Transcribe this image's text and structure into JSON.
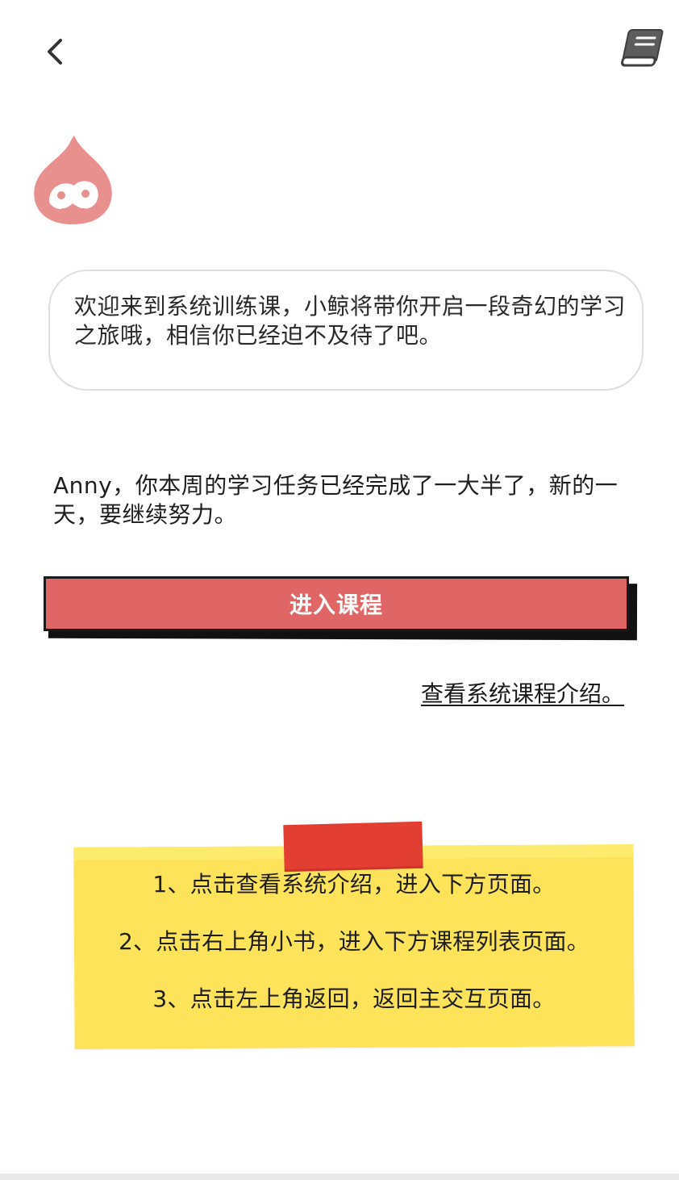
{
  "header": {
    "back_icon": "chevron-left-icon",
    "book_icon": "book-icon"
  },
  "mascot": {
    "icon": "drop-mascot-icon",
    "color": "#e8908e"
  },
  "bubble": {
    "text": "欢迎来到系统训练课，小鲸将带你开启一段奇幻的学习之旅哦，相信你已经迫不及待了吧。"
  },
  "progress": {
    "text": "Anny，你本周的学习任务已经完成了一大半了，新的一天，要继续努力。"
  },
  "enter_button": {
    "label": "进入课程",
    "color": "#e06666"
  },
  "intro_link": {
    "label": "查看系统课程介绍。"
  },
  "note": {
    "color": "#fde35a",
    "tape_color": "#e23e32",
    "items": [
      "1、点击查看系统介绍，进入下方页面。",
      "2、点击右上角小书，进入下方课程列表页面。",
      "3、点击左上角返回，返回主交互页面。"
    ]
  }
}
